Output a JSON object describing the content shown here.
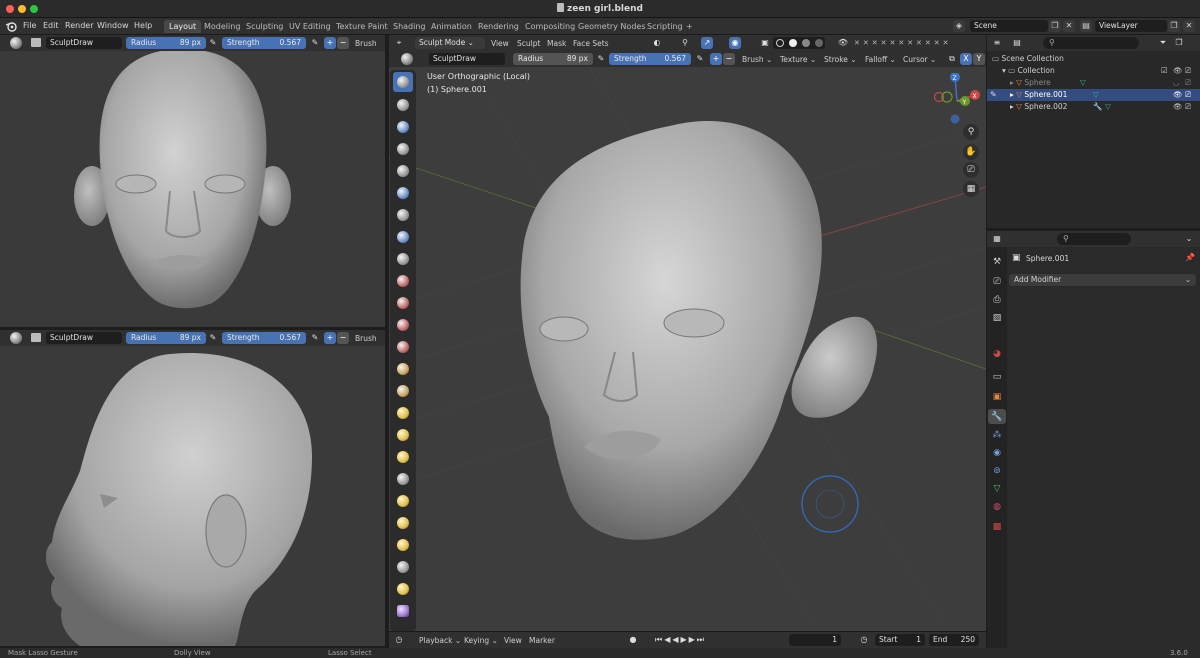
{
  "window": {
    "title": "zeen girl.blend"
  },
  "menu": {
    "items": [
      "File",
      "Edit",
      "Render",
      "Window",
      "Help"
    ]
  },
  "workspaces": {
    "tabs": [
      "Layout",
      "Modeling",
      "Sculpting",
      "UV Editing",
      "Texture Paint",
      "Shading",
      "Animation",
      "Rendering",
      "Compositing",
      "Geometry Nodes",
      "Scripting"
    ],
    "add": "+"
  },
  "scene": {
    "name": "Scene",
    "view_layer": "ViewLayer"
  },
  "left_top": {
    "brush": "SculptDraw",
    "radius_label": "Radius",
    "radius_value": "89 px",
    "strength_label": "Strength",
    "strength_value": "0.567",
    "brush_menu": "Brush"
  },
  "left_bottom": {
    "brush": "SculptDraw",
    "radius_label": "Radius",
    "radius_value": "89 px",
    "strength_label": "Strength",
    "strength_value": "0.567",
    "brush_menu": "Brush"
  },
  "main_header": {
    "mode": "Sculpt Mode",
    "menus": [
      "View",
      "Sculpt",
      "Mask",
      "Face Sets"
    ]
  },
  "main_tool_header": {
    "brush": "SculptDraw",
    "radius_label": "Radius",
    "radius_value": "89 px",
    "strength_label": "Strength",
    "strength_value": "0.567",
    "menus": [
      "Brush",
      "Texture",
      "Stroke",
      "Falloff",
      "Cursor"
    ],
    "axes": [
      "X",
      "Y",
      "Z"
    ]
  },
  "viewport": {
    "line1": "User Orthographic (Local)",
    "line2": "(1) Sphere.001"
  },
  "gizmo": {
    "x": "X",
    "y": "Y",
    "z": "Z"
  },
  "outliner": {
    "root": "Scene Collection",
    "collection": "Collection",
    "objects": [
      "Sphere",
      "Sphere.001",
      "Sphere.002"
    ]
  },
  "properties": {
    "object": "Sphere.001",
    "add_modifier": "Add Modifier"
  },
  "timeline": {
    "menus": [
      "Playback",
      "Keying",
      "View",
      "Marker"
    ],
    "frame": "1",
    "start_label": "Start",
    "start": "1",
    "end_label": "End",
    "end": "250"
  },
  "status": {
    "left": "Mask Lasso Gesture",
    "mid": "Dolly View",
    "right": "Lasso Select",
    "version": "3.6.0"
  },
  "colors": {
    "accent": "#4772b3",
    "selection": "#334d80",
    "x_axis": "#c94848",
    "y_axis": "#6a9a2c",
    "z_axis": "#3d74c7",
    "brush_ring": "#2f6fc4"
  },
  "icons": [
    "blender-logo-icon",
    "sculpt-brush-icon",
    "search-icon",
    "zoom-icon",
    "hand-pan-icon",
    "camera-icon",
    "grid-icon",
    "wrench-icon",
    "eye-icon",
    "camera-render-icon",
    "funnel-icon",
    "pin-icon"
  ]
}
